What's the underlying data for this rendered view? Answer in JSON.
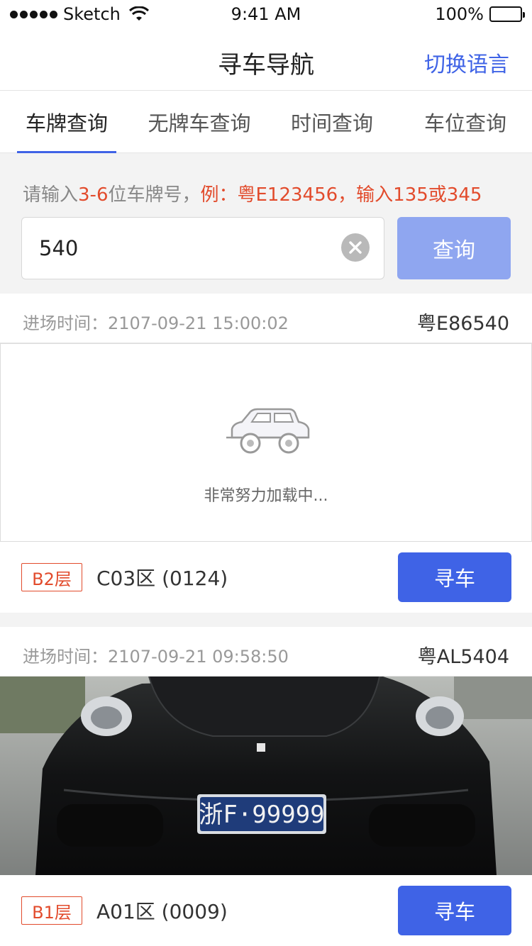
{
  "status_bar": {
    "carrier": "Sketch",
    "time": "9:41 AM",
    "battery": "100%"
  },
  "nav": {
    "title": "寻车导航",
    "action": "切换语言"
  },
  "tabs": [
    {
      "label": "车牌查询",
      "active": true
    },
    {
      "label": "无牌车查询",
      "active": false
    },
    {
      "label": "时间查询",
      "active": false
    },
    {
      "label": "车位查询",
      "active": false
    }
  ],
  "search": {
    "hint_prefix": "请输入",
    "hint_range": "3-6",
    "hint_mid": "位车牌号，",
    "hint_example": "例：粤E123456，输入135或345",
    "value": "540",
    "placeholder": "",
    "button": "查询"
  },
  "accent_color": "#3f63e6",
  "results": [
    {
      "entry_time": "进场时间：2107-09-21 15:00:02",
      "plate": "粤E86540",
      "image_state": "loading",
      "loading_text": "非常努力加载中...",
      "floor": "B2层",
      "zone": "C03区 (0124)",
      "action": "寻车"
    },
    {
      "entry_time": "进场时间：2107-09-21 09:58:50",
      "plate": "粤AL5404",
      "image_state": "photo",
      "photo_plate": "浙F·99999",
      "floor": "B1层",
      "zone": "A01区 (0009)",
      "action": "寻车"
    }
  ]
}
